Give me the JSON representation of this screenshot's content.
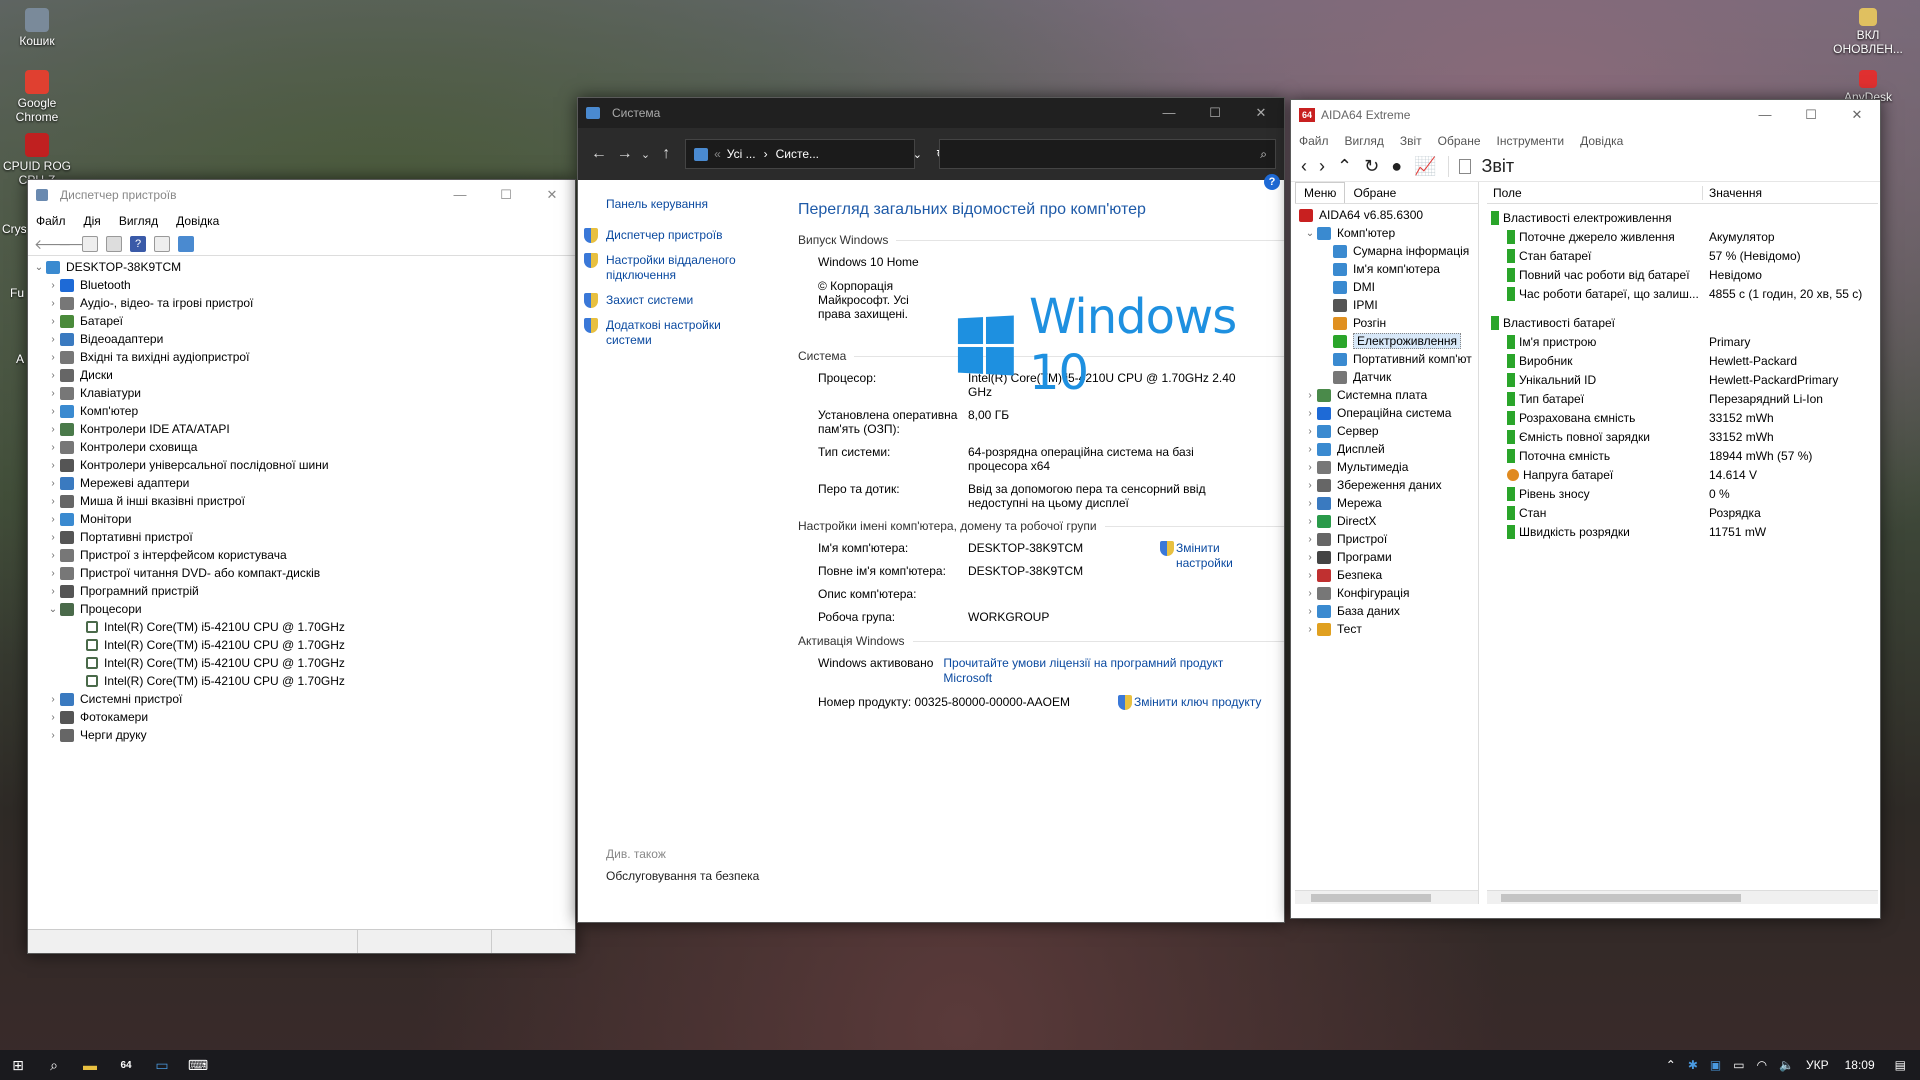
{
  "desktop": {
    "icons": [
      {
        "label": "Кошик",
        "color": "#7a8a9a"
      },
      {
        "label": "Google Chrome",
        "color": "#e04030"
      },
      {
        "label": "CPUID ROG CPU-Z",
        "color": "#c02020"
      }
    ],
    "right_icons": [
      {
        "label": "ВКЛ ОНОВЛЕН...",
        "color": "#e0c060"
      },
      {
        "label": "AnyDesk",
        "color": "#e03030"
      }
    ],
    "partial_labels": [
      "Crys Kure",
      "Fu",
      "A"
    ]
  },
  "devmgr": {
    "title": "Диспетчер пристроїв",
    "menu": [
      "Файл",
      "Дія",
      "Вигляд",
      "Довідка"
    ],
    "root": "DESKTOP-38K9TCM",
    "items": [
      {
        "label": "Bluetooth",
        "color": "#1e6ad6"
      },
      {
        "label": "Аудіо-, відео- та ігрові пристрої",
        "color": "#777"
      },
      {
        "label": "Батареї",
        "color": "#4a8a3a"
      },
      {
        "label": "Відеоадаптери",
        "color": "#3a7ac0"
      },
      {
        "label": "Вхідні та вихідні аудіопристрої",
        "color": "#777"
      },
      {
        "label": "Диски",
        "color": "#666"
      },
      {
        "label": "Клавіатури",
        "color": "#777"
      },
      {
        "label": "Комп'ютер",
        "color": "#3a8ad0"
      },
      {
        "label": "Контролери IDE ATA/ATAPI",
        "color": "#4a7a4a"
      },
      {
        "label": "Контролери сховища",
        "color": "#777"
      },
      {
        "label": "Контролери універсальної послідовної шини",
        "color": "#555"
      },
      {
        "label": "Мережеві адаптери",
        "color": "#3a7ac0"
      },
      {
        "label": "Миша й інші вказівні пристрої",
        "color": "#666"
      },
      {
        "label": "Монітори",
        "color": "#3a8ad0"
      },
      {
        "label": "Портативні пристрої",
        "color": "#555"
      },
      {
        "label": "Пристрої з інтерфейсом користувача",
        "color": "#777"
      },
      {
        "label": "Пристрої читання DVD- або компакт-дисків",
        "color": "#777"
      },
      {
        "label": "Програмний пристрій",
        "color": "#555"
      },
      {
        "label": "Процесори",
        "color": "#4a6a4a",
        "expanded": true,
        "children": [
          "Intel(R) Core(TM) i5-4210U CPU @ 1.70GHz",
          "Intel(R) Core(TM) i5-4210U CPU @ 1.70GHz",
          "Intel(R) Core(TM) i5-4210U CPU @ 1.70GHz",
          "Intel(R) Core(TM) i5-4210U CPU @ 1.70GHz"
        ]
      },
      {
        "label": "Системні пристрої",
        "color": "#3a7ac0"
      },
      {
        "label": "Фотокамери",
        "color": "#555"
      },
      {
        "label": "Черги друку",
        "color": "#666"
      }
    ]
  },
  "system": {
    "title": "Система",
    "address": {
      "part1": "Усі ...",
      "part2": "Систе..."
    },
    "left": {
      "home": "Панель керування",
      "links": [
        "Диспетчер пристроїв",
        "Настройки віддаленого підключення",
        "Захист системи",
        "Додаткові настройки системи"
      ],
      "see_also": "Див. також",
      "security": "Обслуговування та безпека"
    },
    "heading": "Перегляд загальних відомостей про комп'ютер",
    "edition": {
      "section": "Випуск Windows",
      "name": "Windows 10 Home",
      "copyright": "© Корпорація Майкрософт. Усі права захищені.",
      "logo_text": "Windows 10"
    },
    "sys": {
      "section": "Система",
      "rows": [
        {
          "k": "Процесор:",
          "v": "Intel(R) Core(TM) i5-4210U CPU @ 1.70GHz   2.40 GHz"
        },
        {
          "k": "Установлена оперативна пам'ять (ОЗП):",
          "v": "8,00 ГБ"
        },
        {
          "k": "Тип системи:",
          "v": "64-розрядна операційна система на базі процесора x64"
        },
        {
          "k": "Перо та дотик:",
          "v": "Ввід за допомогою пера та сенсорний ввід недоступні на цьому дисплеї"
        }
      ]
    },
    "name": {
      "section": "Настройки імені комп'ютера, домену та робочої групи",
      "change": "Змінити настройки",
      "rows": [
        {
          "k": "Ім'я комп'ютера:",
          "v": "DESKTOP-38K9TCM"
        },
        {
          "k": "Повне ім'я комп'ютера:",
          "v": "DESKTOP-38K9TCM"
        },
        {
          "k": "Опис комп'ютера:",
          "v": ""
        },
        {
          "k": "Робоча група:",
          "v": "WORKGROUP"
        }
      ]
    },
    "activation": {
      "section": "Активація Windows",
      "status": "Windows активовано",
      "license_link": "Прочитайте умови ліцензії на програмний продукт Microsoft",
      "product_label": "Номер продукту: 00325-80000-00000-AAOEM",
      "change_key": "Змінити ключ продукту"
    }
  },
  "aida": {
    "title": "AIDA64 Extreme",
    "menu": [
      "Файл",
      "Вигляд",
      "Звіт",
      "Обране",
      "Інструменти",
      "Довідка"
    ],
    "report": "Звіт",
    "tabs": [
      "Меню",
      "Обране"
    ],
    "version": "AIDA64 v6.85.6300",
    "tree": [
      {
        "label": "Комп'ютер",
        "level": 1,
        "exp": "open",
        "color": "#3a8ad0"
      },
      {
        "label": "Сумарна інформація",
        "level": 2,
        "color": "#3a8ad0"
      },
      {
        "label": "Ім'я комп'ютера",
        "level": 2,
        "color": "#3a8ad0"
      },
      {
        "label": "DMI",
        "level": 2,
        "color": "#3a8ad0"
      },
      {
        "label": "IPMI",
        "level": 2,
        "color": "#555"
      },
      {
        "label": "Розгін",
        "level": 2,
        "color": "#e09020"
      },
      {
        "label": "Електроживлення",
        "level": 2,
        "color": "#2aa52a",
        "selected": true
      },
      {
        "label": "Портативний комп'ют",
        "level": 2,
        "color": "#3a8ad0"
      },
      {
        "label": "Датчик",
        "level": 2,
        "color": "#777"
      },
      {
        "label": "Системна плата",
        "level": 1,
        "exp": "closed",
        "color": "#4a8a4a"
      },
      {
        "label": "Операційна система",
        "level": 1,
        "exp": "closed",
        "color": "#1e6ad6"
      },
      {
        "label": "Сервер",
        "level": 1,
        "exp": "closed",
        "color": "#3a8ad0"
      },
      {
        "label": "Дисплей",
        "level": 1,
        "exp": "closed",
        "color": "#3a8ad0"
      },
      {
        "label": "Мультимедіа",
        "level": 1,
        "exp": "closed",
        "color": "#777"
      },
      {
        "label": "Збереження даних",
        "level": 1,
        "exp": "closed",
        "color": "#666"
      },
      {
        "label": "Мережа",
        "level": 1,
        "exp": "closed",
        "color": "#3a7ac0"
      },
      {
        "label": "DirectX",
        "level": 1,
        "exp": "closed",
        "color": "#2a9a4a"
      },
      {
        "label": "Пристрої",
        "level": 1,
        "exp": "closed",
        "color": "#666"
      },
      {
        "label": "Програми",
        "level": 1,
        "exp": "closed",
        "color": "#444"
      },
      {
        "label": "Безпека",
        "level": 1,
        "exp": "closed",
        "color": "#c03030"
      },
      {
        "label": "Конфігурація",
        "level": 1,
        "exp": "closed",
        "color": "#777"
      },
      {
        "label": "База даних",
        "level": 1,
        "exp": "closed",
        "color": "#3a8ad0"
      },
      {
        "label": "Тест",
        "level": 1,
        "exp": "closed",
        "color": "#e0a020"
      }
    ],
    "headers": {
      "field": "Поле",
      "value": "Значення"
    },
    "groups": [
      {
        "title": "Властивості електроживлення",
        "rows": [
          {
            "f": "Поточне джерело живлення",
            "v": "Акумулятор"
          },
          {
            "f": "Стан батареї",
            "v": "57 % (Невідомо)"
          },
          {
            "f": "Повний час роботи від батареї",
            "v": "Невідомо"
          },
          {
            "f": "Час роботи батареї, що залиш...",
            "v": "4855 с (1 годин, 20 хв, 55 с)"
          }
        ]
      },
      {
        "title": "Властивості батареї",
        "rows": [
          {
            "f": "Ім'я пристрою",
            "v": "Primary"
          },
          {
            "f": "Виробник",
            "v": "Hewlett-Packard"
          },
          {
            "f": "Унікальний ID",
            "v": "Hewlett-PackardPrimary"
          },
          {
            "f": "Тип батареї",
            "v": "Перезарядний Li-Ion"
          },
          {
            "f": "Розрахована ємність",
            "v": "33152 mWh"
          },
          {
            "f": "Ємність повної зарядки",
            "v": "33152 mWh"
          },
          {
            "f": "Поточна ємність",
            "v": "18944 mWh  (57 %)"
          },
          {
            "f": "Напруга батареї",
            "v": "14.614 V",
            "icon": "volt"
          },
          {
            "f": "Рівень зносу",
            "v": "0 %"
          },
          {
            "f": "Стан",
            "v": "Розрядка"
          },
          {
            "f": "Швидкість розрядки",
            "v": "11751 mW"
          }
        ]
      }
    ]
  },
  "taskbar": {
    "lang": "УКР",
    "time": "18:09",
    "apps": [
      {
        "name": "start-button",
        "glyph": "⊞"
      },
      {
        "name": "search-icon",
        "glyph": "⌕"
      },
      {
        "name": "file-explorer-icon",
        "glyph": "▬"
      },
      {
        "name": "aida64-taskbar-icon",
        "glyph": "64"
      },
      {
        "name": "system-window-taskbar-icon",
        "glyph": "▭"
      },
      {
        "name": "device-manager-taskbar-icon",
        "glyph": "⌨"
      }
    ]
  }
}
